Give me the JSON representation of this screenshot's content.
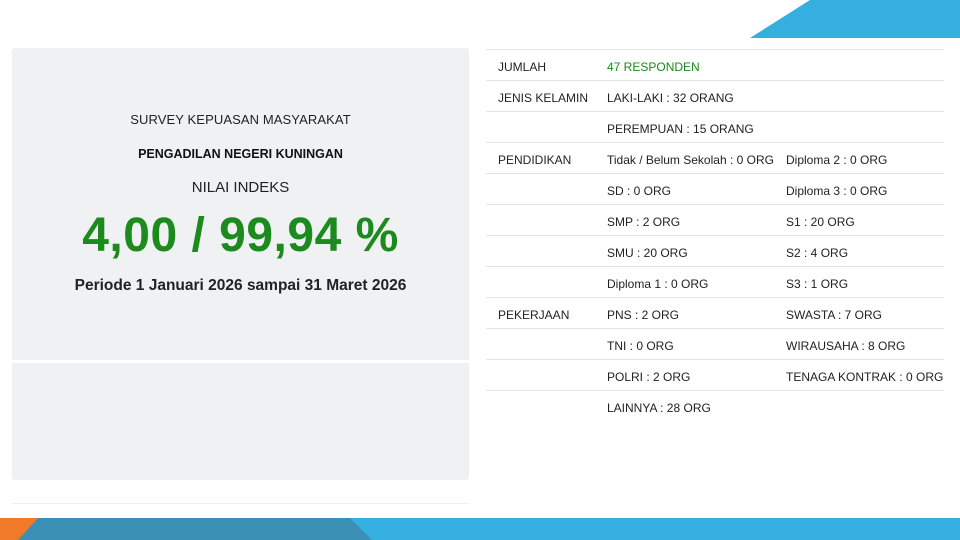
{
  "colors": {
    "accent_green": "#1d8a1d",
    "panel_bg": "#eff1f2",
    "band_blue": "#35aee0",
    "band_dark": "#3a8fb5",
    "band_orange": "#f07a2a"
  },
  "summary": {
    "survey_title": "SURVEY KEPUASAN MASYARAKAT",
    "court_name": "PENGADILAN NEGERI KUNINGAN",
    "index_label": "NILAI INDEKS",
    "index_value": "4,00 / 99,94 %",
    "period": "Periode 1 Januari 2026 sampai 31 Maret 2026"
  },
  "stats": {
    "jumlah": {
      "label": "JUMLAH",
      "value": "47 RESPONDEN"
    },
    "gender": {
      "label": "JENIS KELAMIN",
      "male": "LAKI-LAKI : 32 ORANG",
      "female": "PEREMPUAN : 15 ORANG"
    },
    "education": {
      "label": "PENDIDIKAN",
      "rows": [
        [
          "Tidak / Belum Sekolah : 0 ORG",
          "Diploma 2 : 0 ORG"
        ],
        [
          "SD : 0 ORG",
          "Diploma 3 : 0 ORG"
        ],
        [
          "SMP : 2 ORG",
          "S1 : 20 ORG"
        ],
        [
          "SMU : 20 ORG",
          "S2 : 4 ORG"
        ],
        [
          "Diploma 1 : 0 ORG",
          "S3 : 1 ORG"
        ]
      ]
    },
    "occupation": {
      "label": "PEKERJAAN",
      "rows": [
        [
          "PNS : 2 ORG",
          "SWASTA : 7 ORG"
        ],
        [
          "TNI : 0 ORG",
          "WIRAUSAHA : 8 ORG"
        ],
        [
          "POLRI : 2 ORG",
          "TENAGA KONTRAK : 0 ORG"
        ],
        [
          "LAINNYA : 28 ORG",
          ""
        ]
      ]
    }
  }
}
